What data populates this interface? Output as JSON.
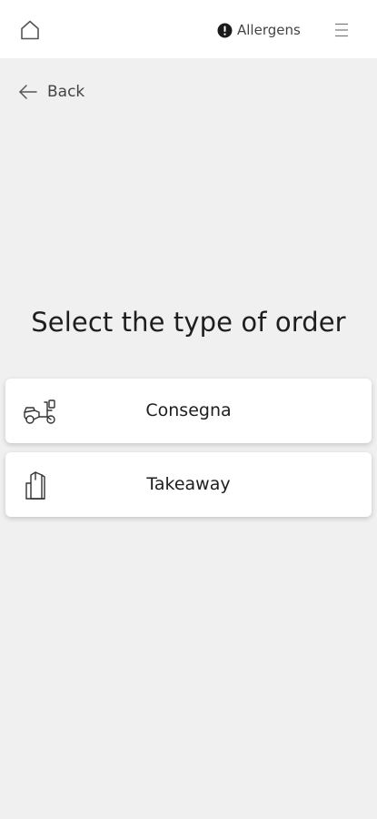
{
  "header": {
    "allergens_label": "Allergens",
    "home_icon": "home-icon",
    "alert_icon": "alert-circle-icon",
    "menu_icon": "hamburger-menu-icon"
  },
  "nav": {
    "back_label": "Back",
    "back_icon": "arrow-left-icon"
  },
  "main": {
    "title": "Select the type of order",
    "options": [
      {
        "label": "Consegna",
        "icon": "scooter-icon"
      },
      {
        "label": "Takeaway",
        "icon": "takeaway-bag-icon"
      }
    ]
  }
}
